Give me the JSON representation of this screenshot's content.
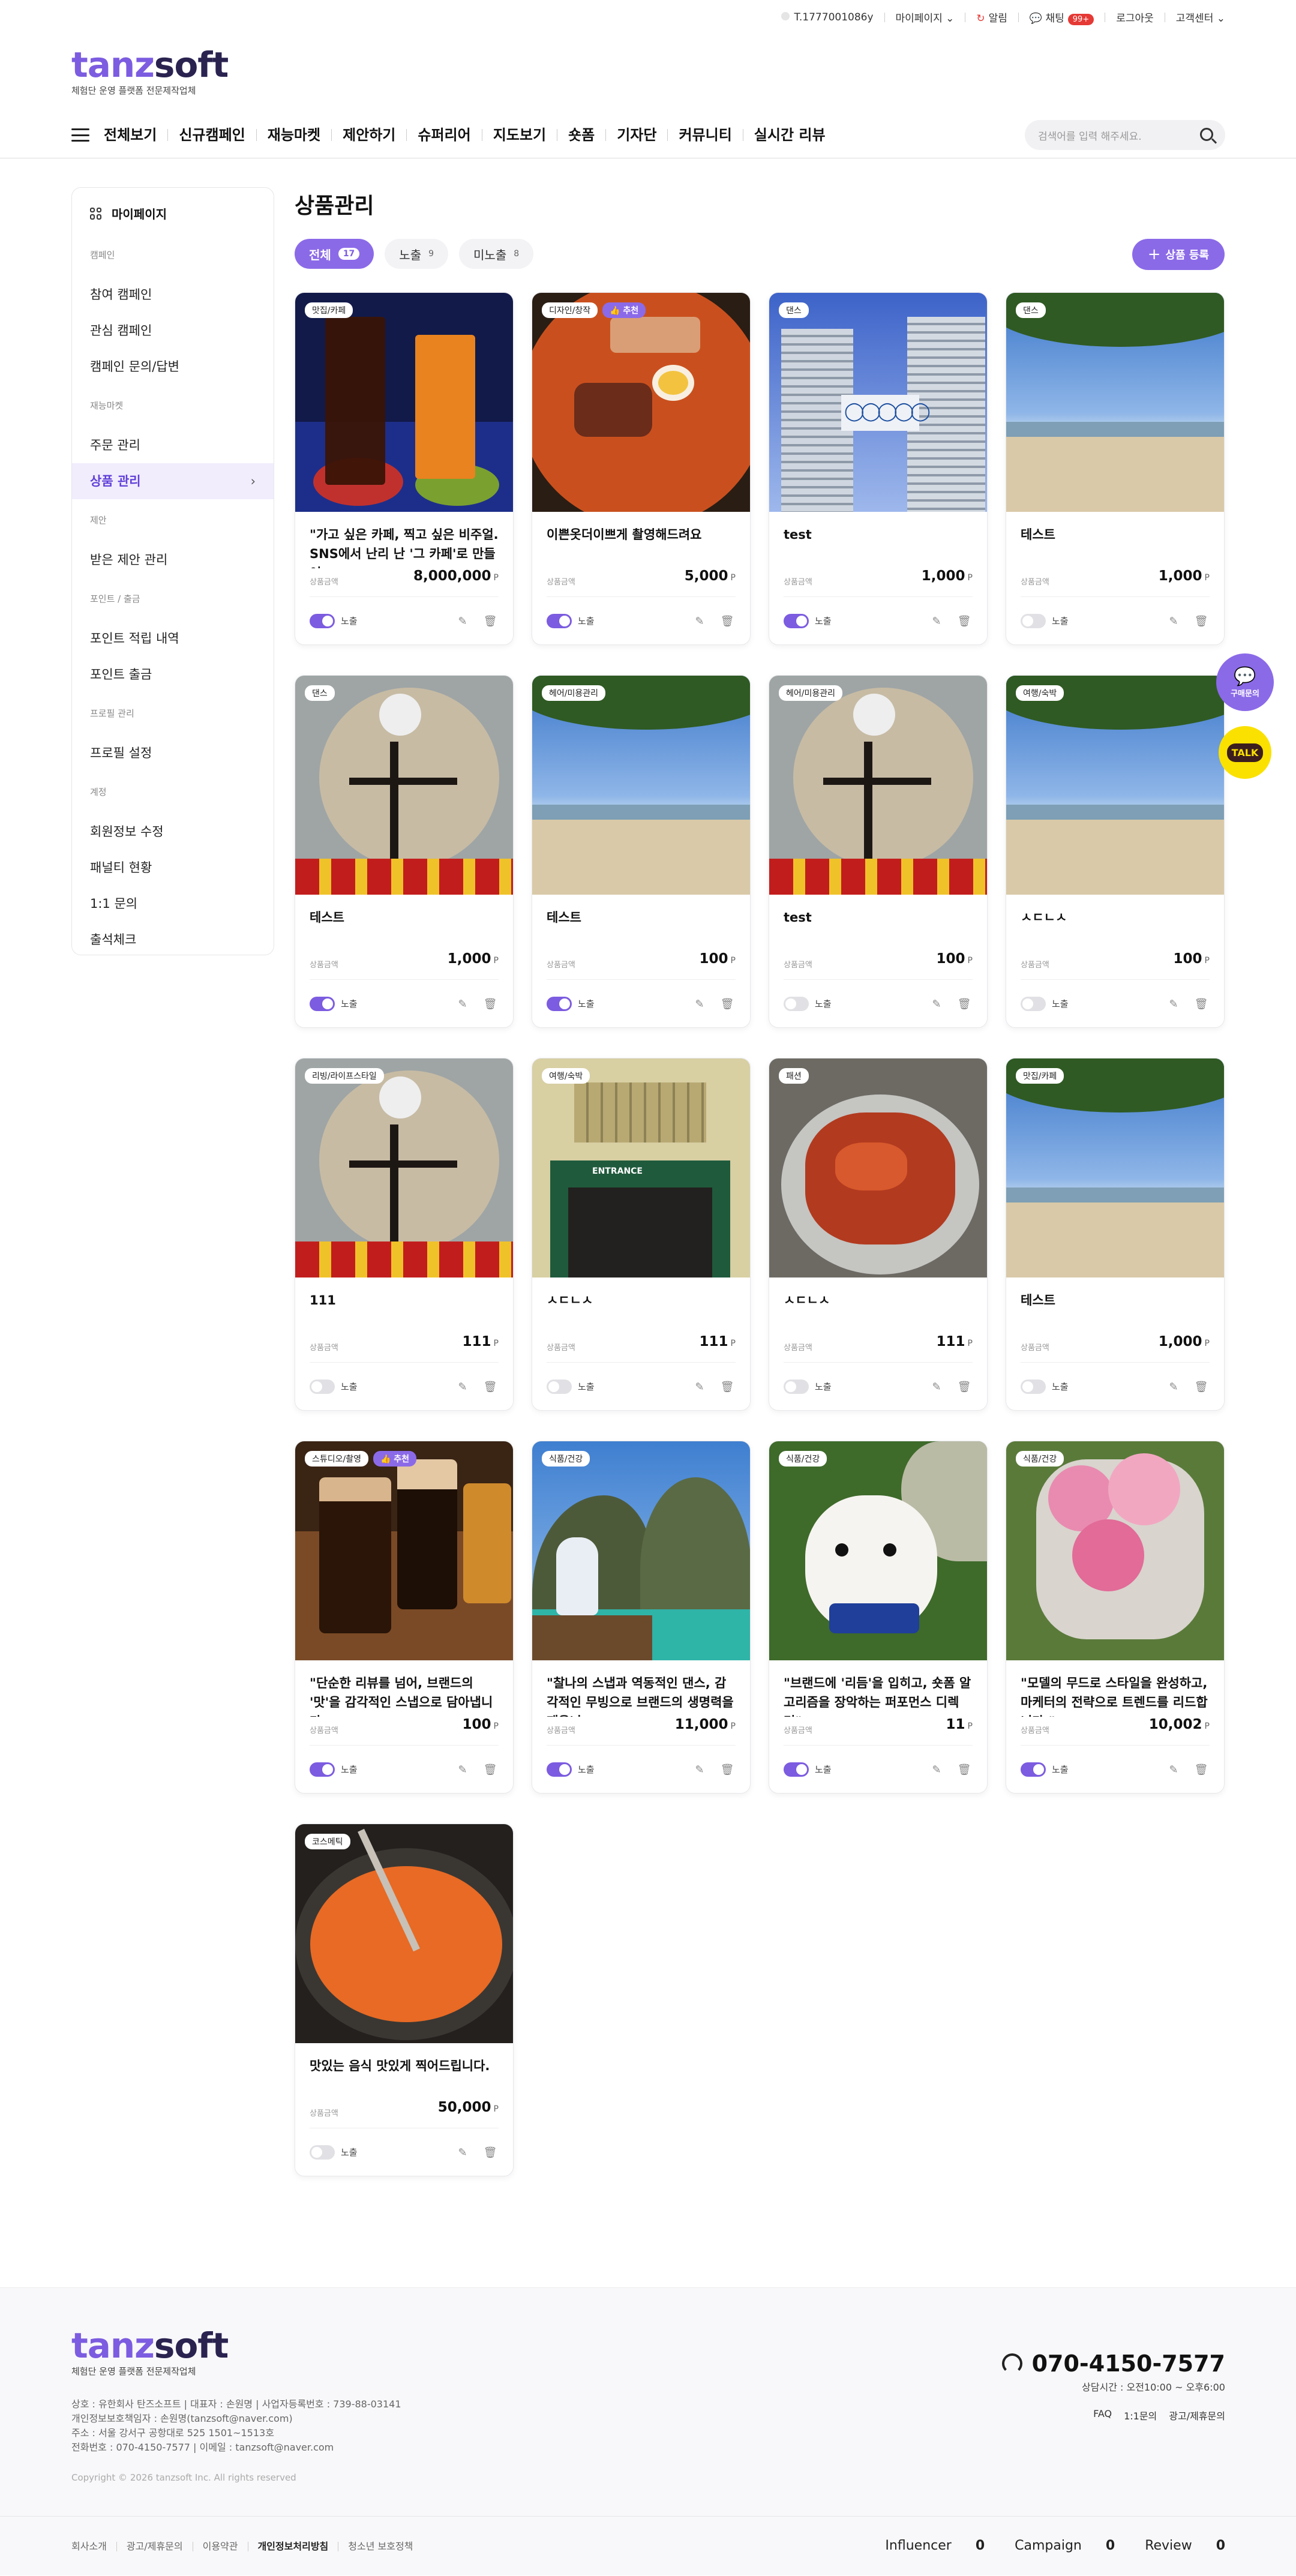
{
  "utility": {
    "phone_id": "T.1777001086y",
    "mypage": "마이페이지",
    "alarm": "알림",
    "chat": "채팅",
    "chat_badge": "99+",
    "logout": "로그아웃",
    "support": "고객센터"
  },
  "logo": {
    "part1": "tanz",
    "part2": "soft",
    "tagline": "체험단 운영 플랫폼 전문제작업체"
  },
  "nav": {
    "items": [
      "전체보기",
      "신규캠페인",
      "재능마켓",
      "제안하기",
      "슈퍼리어",
      "지도보기",
      "숏폼",
      "기자단",
      "커뮤니티",
      "실시간 리뷰"
    ],
    "search_placeholder": "검색어를 입력 해주세요."
  },
  "sidebar": {
    "title": "마이페이지",
    "sections": [
      {
        "label": "캠페인",
        "items": [
          "참여 캠페인",
          "관심 캠페인",
          "캠페인 문의/답변"
        ]
      },
      {
        "label": "재능마켓",
        "items": [
          "주문 관리",
          "상품 관리"
        ]
      },
      {
        "label": "제안",
        "items": [
          "받은 제안 관리"
        ]
      },
      {
        "label": "포인트 / 출금",
        "items": [
          "포인트 적립 내역",
          "포인트 출금"
        ]
      },
      {
        "label": "프로필 관리",
        "items": [
          "프로필 설정"
        ]
      },
      {
        "label": "계정",
        "items": [
          "회원정보 수정",
          "패널티 현황",
          "1:1 문의",
          "출석체크"
        ]
      }
    ]
  },
  "main": {
    "title": "상품관리",
    "tabs": [
      {
        "label": "전체",
        "count": "17"
      },
      {
        "label": "노출",
        "count": "9"
      },
      {
        "label": "미노출",
        "count": "8"
      }
    ],
    "register_label": "상품 등록",
    "price_label": "상품금액",
    "toggle_label": "노출",
    "unit": "P"
  },
  "products": [
    {
      "tags": [
        "맛집/카페"
      ],
      "rec": false,
      "title": "\"가고 싶은 카페, 찍고 싶은 비주얼. SNS에서 난리 난 '그 카페'로 만들어",
      "price": "8,000,000",
      "on": true,
      "img": "drinks"
    },
    {
      "tags": [
        "디자인/창작"
      ],
      "rec": true,
      "title": "이쁜옷더이쁘게 촬영해드려요",
      "price": "5,000",
      "on": true,
      "img": "ramen"
    },
    {
      "tags": [
        "댄스"
      ],
      "rec": false,
      "title": "test",
      "price": "1,000",
      "on": true,
      "img": "olympic"
    },
    {
      "tags": [
        "댄스"
      ],
      "rec": false,
      "title": "테스트",
      "price": "1,000",
      "on": false,
      "img": "beach"
    },
    {
      "tags": [
        "댄스"
      ],
      "rec": false,
      "title": "테스트",
      "price": "1,000",
      "on": true,
      "img": "ceiling"
    },
    {
      "tags": [
        "헤어/미용관리"
      ],
      "rec": false,
      "title": "테스트",
      "price": "100",
      "on": true,
      "img": "beach"
    },
    {
      "tags": [
        "헤어/미용관리"
      ],
      "rec": false,
      "title": "test",
      "price": "100",
      "on": false,
      "img": "ceiling"
    },
    {
      "tags": [
        "여행/숙박"
      ],
      "rec": false,
      "title": "ㅅㄷㄴㅅ",
      "price": "100",
      "on": false,
      "img": "beach"
    },
    {
      "tags": [
        "리빙/라이프스타일"
      ],
      "rec": false,
      "title": "111",
      "price": "111",
      "on": false,
      "img": "ceiling"
    },
    {
      "tags": [
        "여행/숙박"
      ],
      "rec": false,
      "title": "ㅅㄷㄴㅅ",
      "price": "111",
      "on": false,
      "img": "building"
    },
    {
      "tags": [
        "패션"
      ],
      "rec": false,
      "title": "ㅅㄷㄴㅅ",
      "price": "111",
      "on": false,
      "img": "food"
    },
    {
      "tags": [
        "맛집/카페"
      ],
      "rec": false,
      "title": "테스트",
      "price": "1,000",
      "on": false,
      "img": "beach"
    },
    {
      "tags": [
        "스튜디오/촬영"
      ],
      "rec": true,
      "title": "\"단순한 리뷰를 넘어, 브랜드의 '맛'을 감각적인 스냅으로 담아냅니다.",
      "price": "100",
      "on": true,
      "img": "coffee"
    },
    {
      "tags": [
        "식품/건강"
      ],
      "rec": false,
      "title": "\"찰나의 스냅과 역동적인 댄스, 감각적인 무빙으로 브랜드의 생명력을 깨웁니",
      "price": "11,000",
      "on": true,
      "img": "cliff"
    },
    {
      "tags": [
        "식품/건강"
      ],
      "rec": false,
      "title": "\"브랜드에 '리듬'을 입히고, 숏폼 알고리즘을 장악하는 퍼포먼스 디렉터\"",
      "price": "11",
      "on": true,
      "img": "dog"
    },
    {
      "tags": [
        "식품/건강"
      ],
      "rec": false,
      "title": "\"모델의 무드로 스타일을 완성하고, 마케터의 전략으로 트렌드를 리드합니다.\"",
      "price": "10,002",
      "on": true,
      "img": "flowers"
    },
    {
      "tags": [
        "코스메틱"
      ],
      "rec": false,
      "title": "맛있는 음식 맛있게 찍어드립니다.",
      "price": "50,000",
      "on": false,
      "img": "rice"
    }
  ],
  "floating": {
    "chat_label": "구매문의",
    "talk_label": "TALK"
  },
  "footer": {
    "logo1": "tanz",
    "logo2": "soft",
    "tagline": "체험단 운영 플랫폼 전문제작업체",
    "info": [
      "상호 : 유한회사 탄즈소프트 | 대표자 : 손원명 | 사업자등록번호 : 739-88-03141",
      "개인정보보호책임자 : 손원명(tanzsoft@naver.com)",
      "주소 : 서울 강서구 공항대로 525 1501~1513호",
      "전화번호 : 070-4150-7577 | 이메일 : tanzsoft@naver.com"
    ],
    "copyright": "Copyright © 2026 tanzsoft Inc. All rights reserved",
    "phone": "070-4150-7577",
    "hours": "상담시간 : 오전10:00 ~ 오후6:00",
    "links": [
      "FAQ",
      "1:1문의",
      "광고/제휴문의"
    ],
    "bottom_links": [
      "회사소개",
      "광고/제휴문의",
      "이용약관",
      "개인정보처리방침",
      "청소년 보호정책"
    ],
    "stats": [
      {
        "label": "Influencer",
        "value": "0"
      },
      {
        "label": "Campaign",
        "value": "0"
      },
      {
        "label": "Review",
        "value": "0"
      }
    ]
  }
}
